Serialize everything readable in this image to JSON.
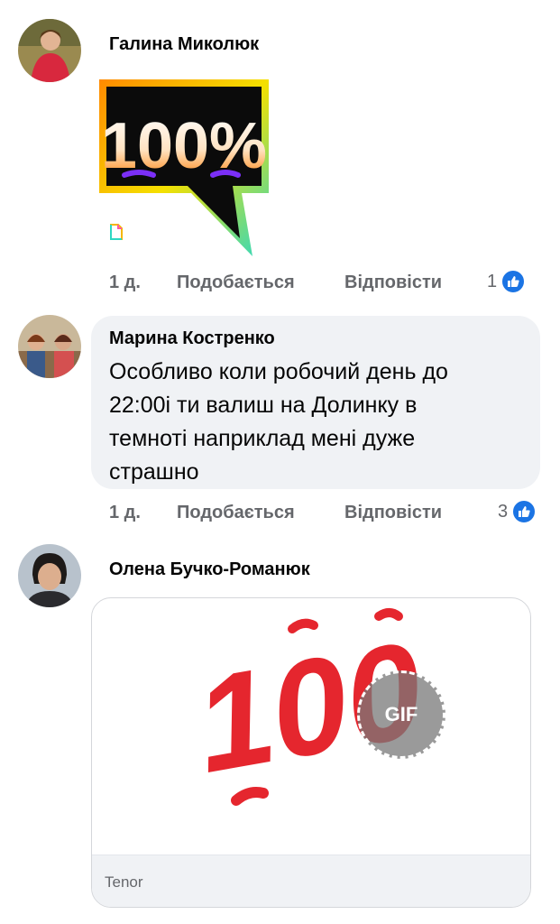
{
  "comments": [
    {
      "author": "Галина Миколюк",
      "sticker_text": "100%",
      "time": "1 д.",
      "like_label": "Подобається",
      "reply_label": "Відповісти",
      "reaction_count": "1"
    },
    {
      "author": "Марина Костренко",
      "text": "Особливо коли робочий день до 22:00і ти валиш на Долинку в темноті наприклад мені дуже страшно",
      "time": "1 д.",
      "like_label": "Подобається",
      "reply_label": "Відповісти",
      "reaction_count": "3"
    },
    {
      "author": "Олена Бучко-Романюк",
      "gif_text": "100",
      "gif_badge": "GIF",
      "gif_source": "Tenor"
    }
  ],
  "colors": {
    "like_blue": "#1b74e4",
    "meta_gray": "#65676b",
    "bubble_bg": "#f0f2f5",
    "gif_red": "#e5262e"
  },
  "icons": [
    "like-thumb-icon",
    "sticker-attachment-icon",
    "gif-badge-icon"
  ]
}
